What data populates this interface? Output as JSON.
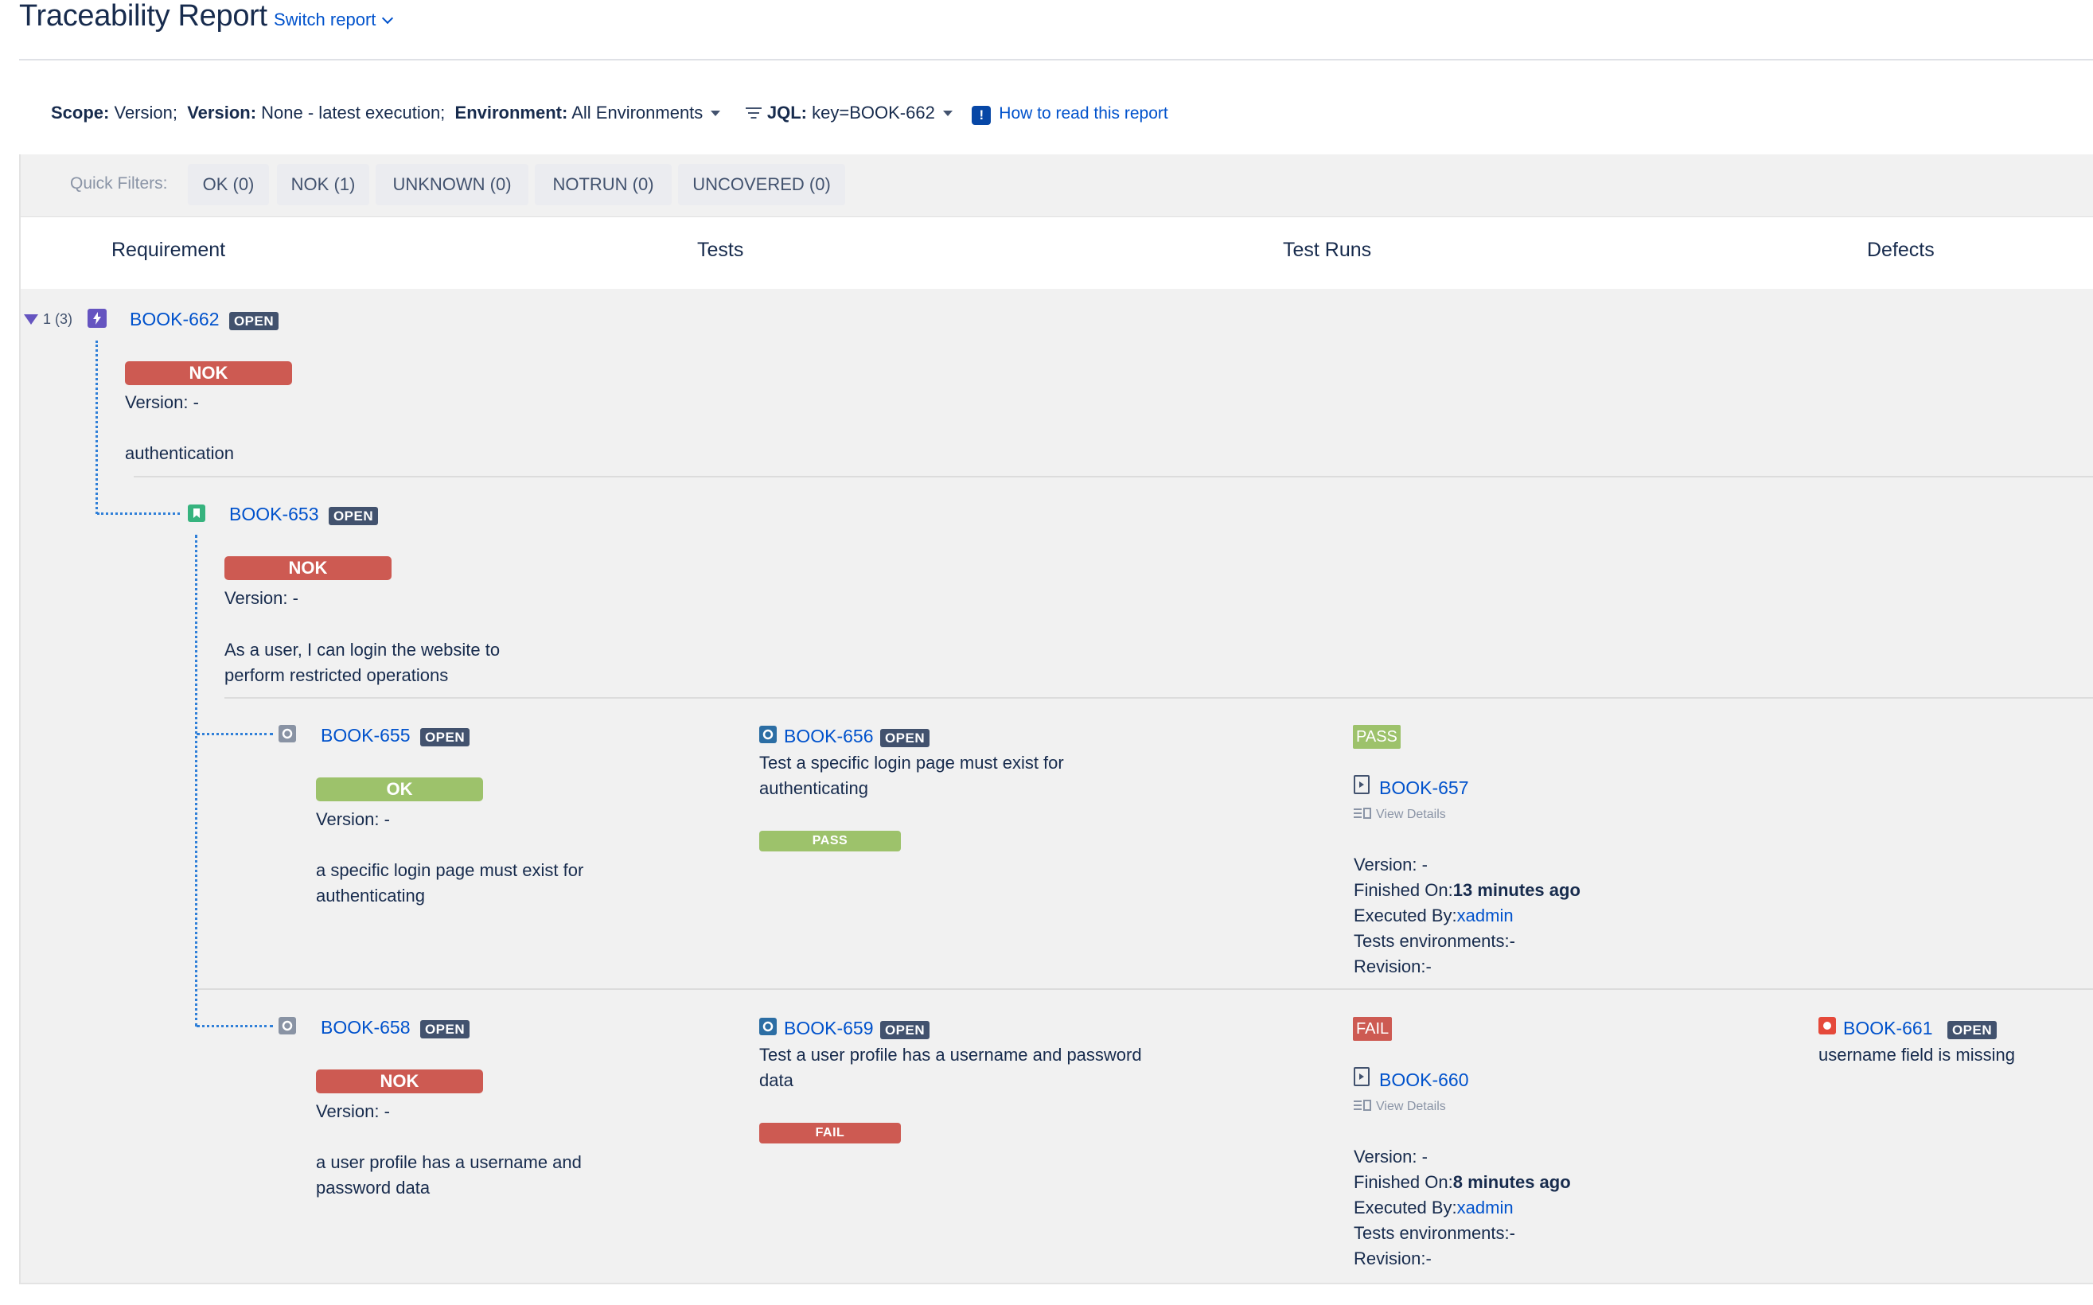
{
  "header": {
    "title": "Traceability Report",
    "switch_label": "Switch report"
  },
  "scope_bar": {
    "scope_label": "Scope:",
    "scope_value": "Version;",
    "version_label": "Version:",
    "version_value": "None - latest execution;",
    "env_label": "Environment:",
    "env_value": "All Environments",
    "jql_label": "JQL:",
    "jql_value": "key=BOOK-662",
    "help_link": "How to read this report",
    "help_icon": "!"
  },
  "quick_filters": {
    "label": "Quick Filters:",
    "items": [
      "OK (0)",
      "NOK (1)",
      "UNKNOWN (0)",
      "NOTRUN (0)",
      "UNCOVERED (0)"
    ]
  },
  "columns": [
    "Requirement",
    "Tests",
    "Test Runs",
    "Defects"
  ],
  "colors": {
    "nok": "#cd5a52",
    "ok": "#9dc26b",
    "link": "#0052cc",
    "open_lozenge": "#42526e",
    "tree_line": "#2f7fd8"
  },
  "rows": {
    "root": {
      "toggle": "1 (3)",
      "key": "BOOK-662",
      "status": "OPEN",
      "coverage": "NOK",
      "version": "Version: -",
      "summary": "authentication"
    },
    "story": {
      "key": "BOOK-653",
      "status": "OPEN",
      "coverage": "NOK",
      "version": "Version: -",
      "summary_line1": "As a user, I can login the website to",
      "summary_line2": "perform restricted operations"
    },
    "req1": {
      "key": "BOOK-655",
      "status": "OPEN",
      "coverage": "OK",
      "version": "Version: -",
      "summary_line1": "a specific login page must exist for",
      "summary_line2": "authenticating",
      "test": {
        "key": "BOOK-656",
        "status": "OPEN",
        "summary_line1": "Test a specific login page must exist for",
        "summary_line2": "authenticating",
        "result": "PASS"
      },
      "run": {
        "result": "PASS",
        "key": "BOOK-657",
        "view_details": "View Details",
        "version": "Version: -",
        "finished_label": "Finished On:",
        "finished_value": "13 minutes ago",
        "executed_label": "Executed By:",
        "executed_value": "xadmin",
        "envs": "Tests environments:-",
        "revision": "Revision:-"
      }
    },
    "req2": {
      "key": "BOOK-658",
      "status": "OPEN",
      "coverage": "NOK",
      "version": "Version: -",
      "summary_line1": "a user profile has a username and",
      "summary_line2": "password data",
      "test": {
        "key": "BOOK-659",
        "status": "OPEN",
        "summary_line1": "Test a user profile has a username and password",
        "summary_line2": "data",
        "result": "FAIL"
      },
      "run": {
        "result": "FAIL",
        "key": "BOOK-660",
        "view_details": "View Details",
        "version": "Version: -",
        "finished_label": "Finished On:",
        "finished_value": "8 minutes ago",
        "executed_label": "Executed By:",
        "executed_value": "xadmin",
        "envs": "Tests environments:-",
        "revision": "Revision:-"
      },
      "defect": {
        "key": "BOOK-661",
        "status": "OPEN",
        "summary": "username field is missing"
      }
    }
  }
}
